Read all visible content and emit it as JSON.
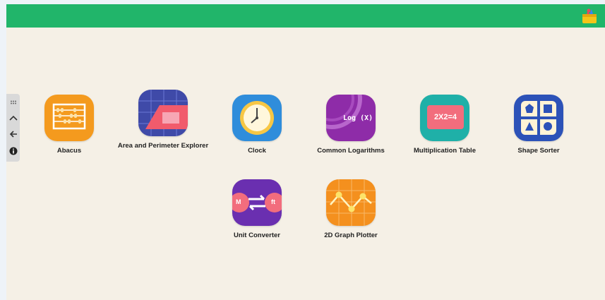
{
  "header": {
    "color": "#21b56a",
    "toolbox_icon": "toolbox-icon"
  },
  "side_controls": [
    "grid-dots-icon",
    "chevron-up-icon",
    "back-arrow-icon",
    "info-icon"
  ],
  "apps_row1": [
    {
      "label": "Abacus",
      "icon": "abacus-icon"
    },
    {
      "label": "Area and Perimeter Explorer",
      "icon": "area-perimeter-icon"
    },
    {
      "label": "Clock",
      "icon": "clock-icon"
    },
    {
      "label": "Common Logarithms",
      "icon": "logarithm-icon",
      "icon_text": "Log (X)"
    },
    {
      "label": "Multiplication Table",
      "icon": "multiplication-icon",
      "icon_text": "2X2=4"
    },
    {
      "label": "Shape Sorter",
      "icon": "shape-sorter-icon"
    }
  ],
  "apps_row2": [
    {
      "label": "Unit Converter",
      "icon": "unit-converter-icon",
      "icon_left": "M",
      "icon_right": "ft"
    },
    {
      "label": "2D Graph Plotter",
      "icon": "graph-plotter-icon"
    }
  ]
}
